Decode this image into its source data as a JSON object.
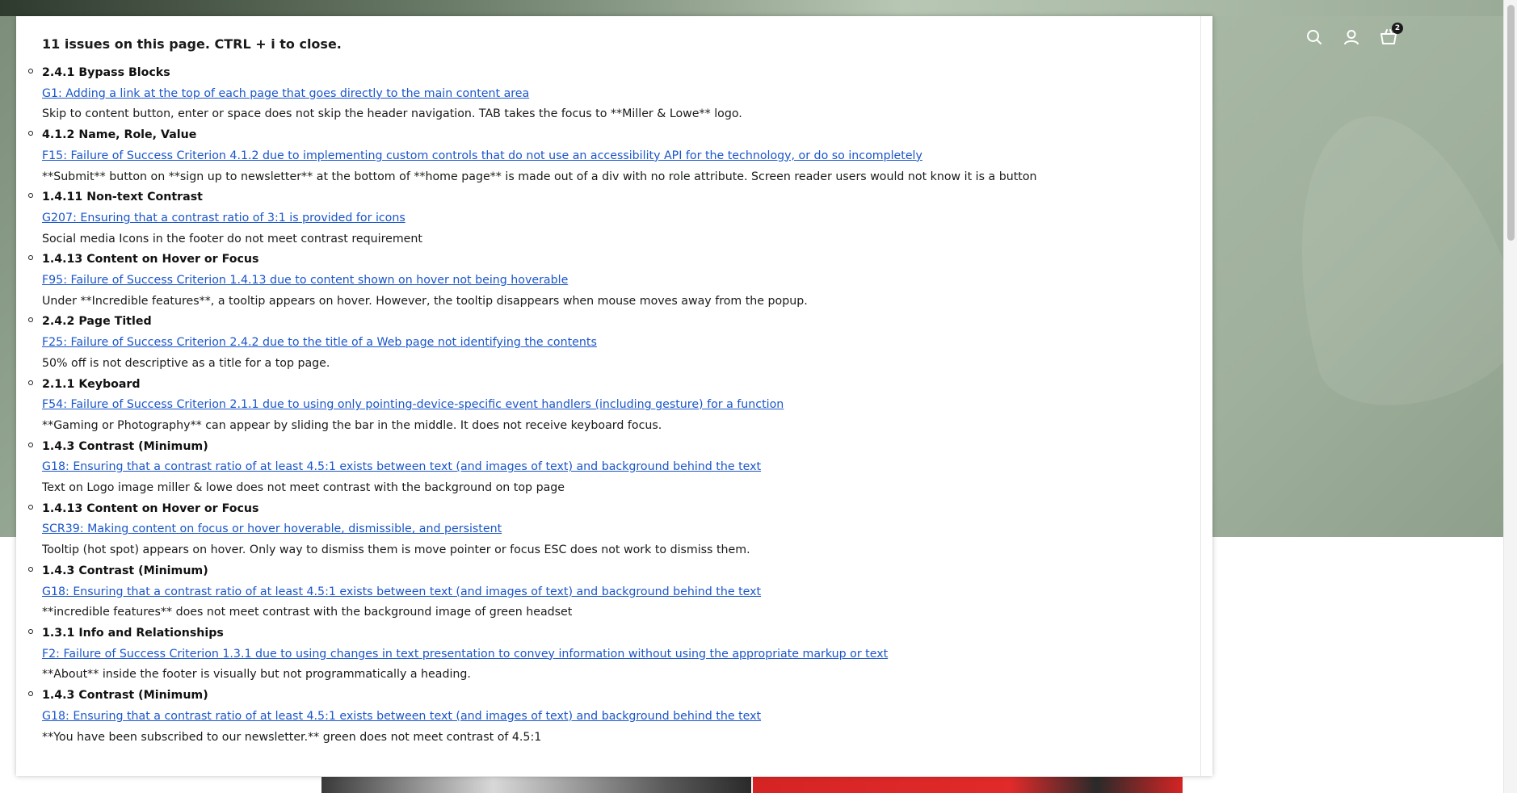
{
  "overlay": {
    "title": "11 issues on this page. CTRL + i to close.",
    "issues": [
      {
        "criterion": "2.4.1 Bypass Blocks",
        "technique": "G1: Adding a link at the top of each page that goes directly to the main content area",
        "description": "Skip to content button, enter or space does not skip the header navigation. TAB takes the focus to **Miller & Lowe** logo."
      },
      {
        "criterion": "4.1.2 Name, Role, Value",
        "technique": "F15: Failure of Success Criterion 4.1.2 due to implementing custom controls that do not use an accessibility API for the technology, or do so incompletely",
        "description": "**Submit** button on **sign up to newsletter** at the bottom of **home page** is made out of a div with no role attribute. Screen reader users would not know it is a button"
      },
      {
        "criterion": "1.4.11 Non-text Contrast",
        "technique": "G207: Ensuring that a contrast ratio of 3:1 is provided for icons",
        "description": "Social media Icons in the footer do not meet contrast requirement"
      },
      {
        "criterion": "1.4.13 Content on Hover or Focus",
        "technique": "F95: Failure of Success Criterion 1.4.13 due to content shown on hover not being hoverable",
        "description": "Under **Incredible features**, a tooltip appears on hover. However, the tooltip disappears when mouse moves away from the popup."
      },
      {
        "criterion": "2.4.2 Page Titled",
        "technique": "F25: Failure of Success Criterion 2.4.2 due to the title of a Web page not identifying the contents",
        "description": "50% off is not descriptive as a title for a top page."
      },
      {
        "criterion": "2.1.1 Keyboard",
        "technique": "F54: Failure of Success Criterion 2.1.1 due to using only pointing-device-specific event handlers (including gesture) for a function",
        "description": "**Gaming or Photography** can appear by sliding the bar in the middle. It does not receive keyboard focus."
      },
      {
        "criterion": "1.4.3 Contrast (Minimum)",
        "technique": "G18: Ensuring that a contrast ratio of at least 4.5:1 exists between text (and images of text) and background behind the text",
        "description": "Text on Logo image miller & lowe does not meet contrast with the background on top page"
      },
      {
        "criterion": "1.4.13 Content on Hover or Focus",
        "technique": "SCR39: Making content on focus or hover hoverable, dismissible, and persistent",
        "description": "Tooltip (hot spot) appears on hover. Only way to dismiss them is move pointer or focus ESC does not work to dismiss them."
      },
      {
        "criterion": "1.4.3 Contrast (Minimum)",
        "technique": "G18: Ensuring that a contrast ratio of at least 4.5:1 exists between text (and images of text) and background behind the text",
        "description": "**incredible features** does not meet contrast with the background image of green headset"
      },
      {
        "criterion": "1.3.1 Info and Relationships",
        "technique": "F2: Failure of Success Criterion 1.3.1 due to using changes in text presentation to convey information without using the appropriate markup or text",
        "description": "**About** inside the footer is visually but not programmatically a heading."
      },
      {
        "criterion": "1.4.3 Contrast (Minimum)",
        "technique": "G18: Ensuring that a contrast ratio of at least 4.5:1 exists between text (and images of text) and background behind the text",
        "description": "**You have been subscribed to our newsletter.** green does not meet contrast of 4.5:1"
      }
    ]
  },
  "header": {
    "icons": [
      "search-icon",
      "account-icon",
      "cart-icon"
    ],
    "cart_count": "2"
  },
  "colors": {
    "link": "#1a56c9",
    "text": "#1a1a1a",
    "hero_green": "#97aa95"
  }
}
